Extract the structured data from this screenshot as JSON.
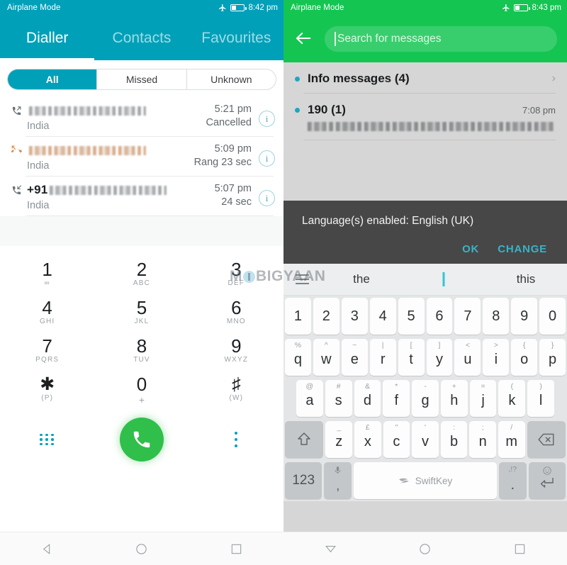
{
  "left": {
    "status_bar": {
      "label": "Airplane Mode",
      "airplane_icon": "airplane-icon",
      "battery_icon": "battery-icon",
      "time": "8:42 pm"
    },
    "tabs": [
      {
        "label": "Dialler",
        "active": true
      },
      {
        "label": "Contacts",
        "active": false
      },
      {
        "label": "Favourites",
        "active": false
      }
    ],
    "filters": [
      {
        "label": "All",
        "active": true
      },
      {
        "label": "Missed",
        "active": false
      },
      {
        "label": "Unknown",
        "active": false
      }
    ],
    "calls": [
      {
        "icon": "outgoing-call-icon",
        "prefix": "",
        "number": "redacted",
        "location": "India",
        "time": "5:21 pm",
        "status": "Cancelled",
        "info": "i"
      },
      {
        "icon": "missed-call-icon",
        "prefix": "",
        "number": "redacted",
        "location": "India",
        "time": "5:09 pm",
        "status": "Rang 23 sec",
        "info": "i"
      },
      {
        "icon": "incoming-call-icon",
        "prefix": "+91",
        "number": "redacted",
        "location": "India",
        "time": "5:07 pm",
        "status": "24 sec",
        "info": "i"
      }
    ],
    "dialpad": [
      [
        {
          "digit": "1",
          "sub": "∞"
        },
        {
          "digit": "2",
          "sub": "ABC"
        },
        {
          "digit": "3",
          "sub": "DEF"
        }
      ],
      [
        {
          "digit": "4",
          "sub": "GHI"
        },
        {
          "digit": "5",
          "sub": "JKL"
        },
        {
          "digit": "6",
          "sub": "MNO"
        }
      ],
      [
        {
          "digit": "7",
          "sub": "PQRS"
        },
        {
          "digit": "8",
          "sub": "TUV"
        },
        {
          "digit": "9",
          "sub": "WXYZ"
        }
      ],
      [
        {
          "digit": "★",
          "sub": "(P)"
        },
        {
          "digit": "0",
          "sub": "+"
        },
        {
          "digit": "#",
          "sub": "(W)"
        }
      ]
    ],
    "actions": {
      "keypad_icon": "keypad-icon",
      "call_icon": "call-icon",
      "overflow_icon": "overflow-menu-icon"
    },
    "navbar": {
      "back_icon": "back-triangle-icon",
      "home_icon": "home-circle-icon",
      "recents_icon": "recents-square-icon"
    },
    "colors": {
      "accent": "#00a0b9",
      "call_button": "#30bf4a"
    }
  },
  "right": {
    "status_bar": {
      "label": "Airplane Mode",
      "airplane_icon": "airplane-icon",
      "battery_icon": "battery-icon",
      "time": "8:43 pm"
    },
    "search": {
      "back_icon": "back-arrow-icon",
      "placeholder": "Search for messages",
      "value": ""
    },
    "threads": [
      {
        "title": "Info messages (4)",
        "time": "",
        "chevron": "›",
        "preview": "",
        "unread_dot": true
      },
      {
        "title": "190 (1)",
        "time": "7:08 pm",
        "chevron": "",
        "preview": "redacted",
        "unread_dot": true
      }
    ],
    "dialog": {
      "message": "Language(s) enabled: English (UK)",
      "ok_label": "OK",
      "change_label": "CHANGE"
    },
    "keyboard": {
      "menu_icon": "hamburger-menu-icon",
      "suggestions": [
        "the",
        "I",
        "this"
      ],
      "selected_suggestion_index": 1,
      "number_row": [
        "1",
        "2",
        "3",
        "4",
        "5",
        "6",
        "7",
        "8",
        "9",
        "0"
      ],
      "row1": [
        {
          "main": "q",
          "alt": "%"
        },
        {
          "main": "w",
          "alt": "^"
        },
        {
          "main": "e",
          "alt": "~"
        },
        {
          "main": "r",
          "alt": "|"
        },
        {
          "main": "t",
          "alt": "["
        },
        {
          "main": "y",
          "alt": "]"
        },
        {
          "main": "u",
          "alt": "<"
        },
        {
          "main": "i",
          "alt": ">"
        },
        {
          "main": "o",
          "alt": "{"
        },
        {
          "main": "p",
          "alt": "}"
        }
      ],
      "row2": [
        {
          "main": "a",
          "alt": "@"
        },
        {
          "main": "s",
          "alt": "#"
        },
        {
          "main": "d",
          "alt": "&"
        },
        {
          "main": "f",
          "alt": "*"
        },
        {
          "main": "g",
          "alt": "-"
        },
        {
          "main": "h",
          "alt": "+"
        },
        {
          "main": "j",
          "alt": "="
        },
        {
          "main": "k",
          "alt": "("
        },
        {
          "main": "l",
          "alt": ")"
        }
      ],
      "row3": [
        {
          "main": "z",
          "alt": "_"
        },
        {
          "main": "x",
          "alt": "£"
        },
        {
          "main": "c",
          "alt": "\""
        },
        {
          "main": "v",
          "alt": "'"
        },
        {
          "main": "b",
          "alt": ":"
        },
        {
          "main": "n",
          "alt": ";"
        },
        {
          "main": "m",
          "alt": "/"
        }
      ],
      "shift_icon": "shift-icon",
      "backspace_icon": "backspace-icon",
      "numeric_label": "123",
      "comma_label": ",",
      "mic_icon": "microphone-icon",
      "space_label": "SwiftKey",
      "space_logo_icon": "swiftkey-logo-icon",
      "period_label": ".",
      "period_alt": ",!?",
      "emoji_icon": "smiley-icon",
      "enter_icon": "enter-icon"
    },
    "navbar": {
      "back_icon": "hide-keyboard-triangle-icon",
      "home_icon": "home-circle-icon",
      "recents_icon": "recents-square-icon"
    },
    "colors": {
      "accent": "#14c552",
      "dialog_bg": "#474747",
      "dialog_action": "#38b3c9"
    }
  },
  "watermark": {
    "part1": "M",
    "part2": "BIGYAAN"
  }
}
